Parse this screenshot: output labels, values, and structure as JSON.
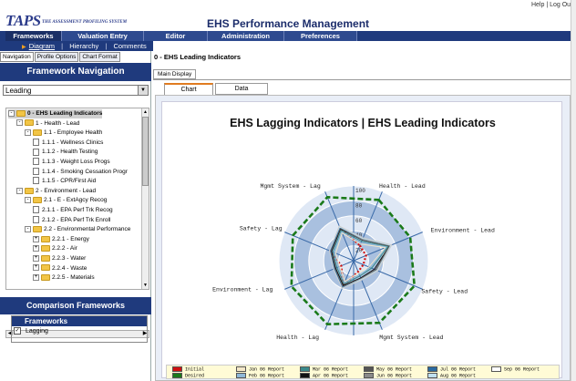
{
  "app": {
    "logo_text": "TAPS",
    "logo_sub": "THE ASSESSMENT PROFILING SYSTEM",
    "title": "EHS Performance Management",
    "help": "Help",
    "logout": "Log Out"
  },
  "main_nav": [
    "Frameworks",
    "Valuation Entry",
    "Editor",
    "Administration",
    "Preferences"
  ],
  "sub_nav": [
    "Diagram",
    "Hierarchy",
    "Comments"
  ],
  "left_tabs": [
    "Navigation",
    "Profile Options",
    "Chart Format"
  ],
  "framework_nav": {
    "title": "Framework Navigation",
    "selected": "Leading"
  },
  "tree": [
    {
      "label": "0 - EHS Leading Indicators",
      "level": 0,
      "type": "folder",
      "exp": "-"
    },
    {
      "label": "1 - Health - Lead",
      "level": 1,
      "type": "folder",
      "exp": "-"
    },
    {
      "label": "1.1 - Employee Health",
      "level": 2,
      "type": "folder",
      "exp": "-"
    },
    {
      "label": "1.1.1 - Wellness Clinics",
      "level": 3,
      "type": "doc",
      "exp": ""
    },
    {
      "label": "1.1.2 - Health Testing",
      "level": 3,
      "type": "doc",
      "exp": ""
    },
    {
      "label": "1.1.3 - Weight Loss Progs",
      "level": 3,
      "type": "doc",
      "exp": ""
    },
    {
      "label": "1.1.4 - Smoking Cessation Progr",
      "level": 3,
      "type": "doc",
      "exp": ""
    },
    {
      "label": "1.1.5 - CPR/First Aid",
      "level": 3,
      "type": "doc",
      "exp": ""
    },
    {
      "label": "2 - Environment - Lead",
      "level": 1,
      "type": "folder",
      "exp": "-"
    },
    {
      "label": "2.1 - E - ExtAgcy Recog",
      "level": 2,
      "type": "folder",
      "exp": "-"
    },
    {
      "label": "2.1.1 - EPA Perf Trk Recog",
      "level": 3,
      "type": "doc",
      "exp": ""
    },
    {
      "label": "2.1.2 - EPA Perf Trk Enroll",
      "level": 3,
      "type": "doc",
      "exp": ""
    },
    {
      "label": "2.2 - Environmental Performance",
      "level": 2,
      "type": "folder",
      "exp": "-"
    },
    {
      "label": "2.2.1 - Energy",
      "level": 3,
      "type": "folder",
      "exp": "+"
    },
    {
      "label": "2.2.2 - Air",
      "level": 3,
      "type": "folder",
      "exp": "+"
    },
    {
      "label": "2.2.3 - Water",
      "level": 3,
      "type": "folder",
      "exp": "+"
    },
    {
      "label": "2.2.4 - Waste",
      "level": 3,
      "type": "folder",
      "exp": "+"
    },
    {
      "label": "2.2.5 - Materials",
      "level": 3,
      "type": "folder",
      "exp": "+"
    }
  ],
  "comparison": {
    "title": "Comparison Frameworks",
    "header": "Frameworks",
    "items": [
      {
        "label": "Lagging",
        "checked": "✓"
      }
    ]
  },
  "breadcrumb": "0 - EHS Leading Indicators",
  "main_display_tab": "Main Display",
  "chart_tabs": [
    "Chart",
    "Data"
  ],
  "chart_data": {
    "type": "radar",
    "title": "EHS Lagging Indicators | EHS Leading Indicators",
    "axes": [
      "Health - Lead",
      "Environment - Lead",
      "Safety - Lead",
      "Mgmt System - Lead",
      "Health - Lag",
      "Environment - Lag",
      "Safety - Lag",
      "Mgmt System - Lag"
    ],
    "rlim": [
      0,
      100
    ],
    "ticks": [
      20,
      40,
      60,
      80,
      100
    ],
    "series": [
      {
        "name": "Initial",
        "color": "#d01010",
        "values": [
          22,
          18,
          14,
          16,
          36,
          18,
          34,
          48
        ]
      },
      {
        "name": "Desired",
        "color": "#1a7a1a",
        "values": [
          88,
          82,
          88,
          90,
          92,
          90,
          88,
          92
        ]
      },
      {
        "name": "Jan 06 Report",
        "color": "#f4e8c8",
        "values": [
          24,
          46,
          22,
          18,
          30,
          20,
          26,
          40
        ]
      },
      {
        "name": "Feb 06 Report",
        "color": "#8fb8d8",
        "values": [
          26,
          48,
          24,
          20,
          32,
          22,
          28,
          42
        ]
      },
      {
        "name": "Mar 06 Report",
        "color": "#3a8a8a",
        "values": [
          28,
          50,
          26,
          22,
          34,
          24,
          30,
          44
        ]
      },
      {
        "name": "Apr 06 Report",
        "color": "#111111",
        "values": [
          30,
          52,
          30,
          25,
          36,
          26,
          32,
          46
        ]
      },
      {
        "name": "May 06 Report",
        "color": "#555555",
        "values": [
          30,
          52,
          32,
          26,
          38,
          27,
          33,
          47
        ]
      },
      {
        "name": "Jun 06 Report",
        "color": "#8a8a8a",
        "values": [
          31,
          53,
          33,
          26,
          38,
          28,
          34,
          48
        ]
      },
      {
        "name": "Jul 06 Report",
        "color": "#2a6aa0",
        "values": [
          32,
          54,
          34,
          27,
          39,
          28,
          34,
          48
        ]
      },
      {
        "name": "Aug 06 Report",
        "color": "#bfe0f0",
        "values": [
          32,
          54,
          34,
          27,
          40,
          29,
          35,
          49
        ]
      },
      {
        "name": "Sep 06 Report",
        "color": "#ffffff",
        "values": [
          33,
          55,
          35,
          28,
          40,
          29,
          35,
          50
        ]
      }
    ]
  },
  "colors": {
    "nav_blue": "#1f3a7d",
    "ring_light": "#dfe8f5",
    "ring_dark": "#a9c0df",
    "legend_bg": "#fffbd6"
  }
}
